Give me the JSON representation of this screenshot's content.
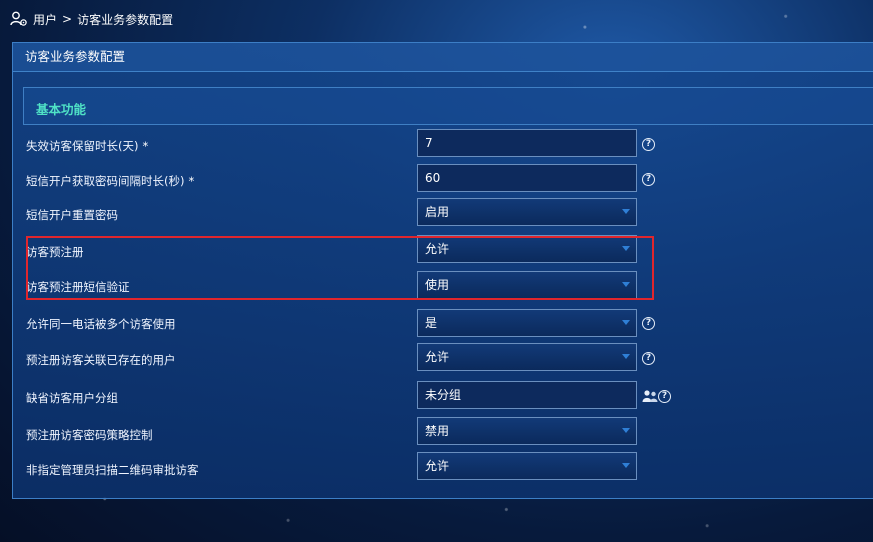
{
  "breadcrumb": {
    "root": "用户",
    "separator": ">",
    "current": "访客业务参数配置"
  },
  "panel": {
    "title": "访客业务参数配置"
  },
  "section": {
    "title": "基本功能"
  },
  "fields": [
    {
      "label": "失效访客保留时长(天)",
      "required": "*",
      "value": "7",
      "type": "input",
      "help": "?"
    },
    {
      "label": "短信开户获取密码间隔时长(秒)",
      "required": "*",
      "value": "60",
      "type": "input",
      "help": "?"
    },
    {
      "label": "短信开户重置密码",
      "value": "启用",
      "type": "select"
    },
    {
      "label": "访客预注册",
      "value": "允许",
      "type": "select"
    },
    {
      "label": "访客预注册短信验证",
      "value": "使用",
      "type": "select"
    },
    {
      "label": "允许同一电话被多个访客使用",
      "value": "是",
      "type": "select",
      "help": "?"
    },
    {
      "label": "预注册访客关联已存在的用户",
      "value": "允许",
      "type": "select",
      "help": "?"
    },
    {
      "label": "缺省访客用户分组",
      "value": "未分组",
      "type": "input",
      "icon": "users-icon",
      "help": "?"
    },
    {
      "label": "预注册访客密码策略控制",
      "value": "禁用",
      "type": "select"
    },
    {
      "label": "非指定管理员扫描二维码审批访客",
      "value": "允许",
      "type": "select"
    }
  ],
  "colors": {
    "section_title": "#4fe2c6",
    "highlight_border": "#e0262d",
    "background": "#0d2f63"
  }
}
